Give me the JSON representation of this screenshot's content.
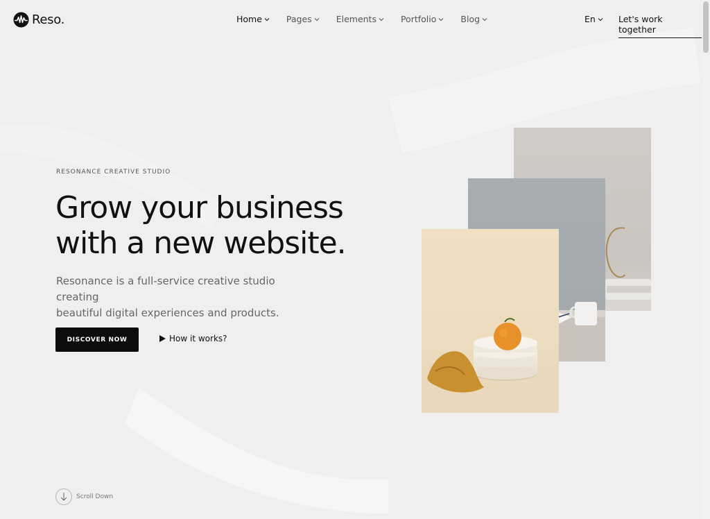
{
  "brand": {
    "name": "Reso."
  },
  "nav": {
    "items": [
      {
        "label": "Home",
        "active": true
      },
      {
        "label": "Pages",
        "active": false
      },
      {
        "label": "Elements",
        "active": false
      },
      {
        "label": "Portfolio",
        "active": false
      },
      {
        "label": "Blog",
        "active": false
      }
    ],
    "language": "En",
    "cta": "Let's work together"
  },
  "hero": {
    "eyebrow": "RESONANCE CREATIVE STUDIO",
    "headline_line1": "Grow your business",
    "headline_line2": "with a new website.",
    "subtext_line1": "Resonance is a full-service creative studio creating",
    "subtext_line2": "beautiful digital experiences and products.",
    "primary_button": "DISCOVER NOW",
    "secondary_button": "How it works?"
  },
  "scroll": {
    "label": "Scroll Down"
  },
  "colors": {
    "background": "#efefef",
    "text": "#111111",
    "button": "#0c0c0c",
    "orange": "#e8902a"
  },
  "icons": {
    "logo": "waveform-logo-icon",
    "chevron": "chevron-down-icon",
    "play": "play-icon",
    "scroll": "arrow-down-icon"
  }
}
